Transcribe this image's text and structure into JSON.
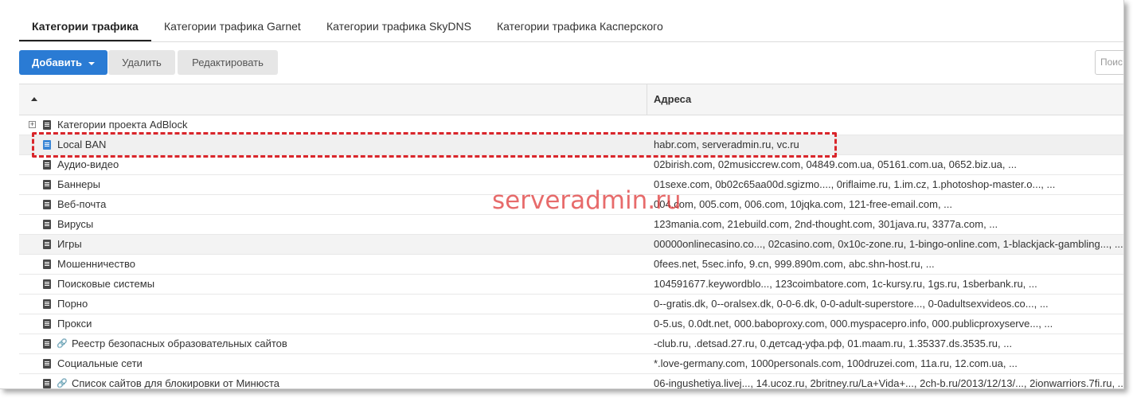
{
  "tabs": [
    {
      "label": "Категории трафика",
      "active": true
    },
    {
      "label": "Категории трафика Garnet",
      "active": false
    },
    {
      "label": "Категории трафика SkyDNS",
      "active": false
    },
    {
      "label": "Категории трафика Касперского",
      "active": false
    }
  ],
  "toolbar": {
    "add_label": "Добавить",
    "delete_label": "Удалить",
    "edit_label": "Редактировать",
    "search_placeholder": "Поис"
  },
  "table": {
    "header_addresses": "Адреса",
    "rows": [
      {
        "name": "Категории проекта AdBlock",
        "addresses": "",
        "icon": "book-icon",
        "expandable": true
      },
      {
        "name": "Local BAN",
        "addresses": "habr.com, serveradmin.ru, vc.ru",
        "icon": "book-icon",
        "selected": true
      },
      {
        "name": "Аудио-видео",
        "addresses": "02birish.com, 02musiccrew.com, 04849.com.ua, 05161.com.ua, 0652.biz.ua, ...",
        "icon": "book-icon"
      },
      {
        "name": "Баннеры",
        "addresses": "01sexe.com, 0b02c65aa00d.sgizmo...., 0riflaime.ru, 1.im.cz, 1.photoshop-master.o..., ...",
        "icon": "book-icon"
      },
      {
        "name": "Веб-почта",
        "addresses": "004.com, 005.com, 006.com, 10jqka.com, 121-free-email.com, ...",
        "icon": "book-icon"
      },
      {
        "name": "Вирусы",
        "addresses": "123mania.com, 21ebuild.com, 2nd-thought.com, 301java.ru, 3377a.com, ...",
        "icon": "book-icon"
      },
      {
        "name": "Игры",
        "addresses": "00000onlinecasino.co..., 02casino.com, 0x10c-zone.ru, 1-bingo-online.com, 1-blackjack-gambling..., ...",
        "icon": "book-icon",
        "hover": true
      },
      {
        "name": "Мошенничество",
        "addresses": "0fees.net, 5sec.info, 9.cn, 999.890m.com, abc.shn-host.ru, ...",
        "icon": "book-icon"
      },
      {
        "name": "Поисковые системы",
        "addresses": "104591677.keywordblo..., 123coimbatore.com, 1c-kursy.ru, 1gs.ru, 1sberbank.ru, ...",
        "icon": "book-icon"
      },
      {
        "name": "Порно",
        "addresses": "0--gratis.dk, 0--oralsex.dk, 0-0-6.dk, 0-0-adult-superstore..., 0-0adultsexvideos.co..., ...",
        "icon": "book-icon"
      },
      {
        "name": "Прокси",
        "addresses": "0-5.us, 0.0dt.net, 000.baboproxy.com, 000.myspacepro.info, 000.publicproxyserve..., ...",
        "icon": "book-icon"
      },
      {
        "name": "Реестр безопасных образовательных сайтов",
        "addresses": "-club.ru, .detsad.27.ru, 0.детсад-уфа.рф, 01.maam.ru, 1.35337.ds.3535.ru, ...",
        "icon": "book-icon",
        "link": true
      },
      {
        "name": "Социальные сети",
        "addresses": "*.love-germany.com, 1000personals.com, 100druzei.com, 11a.ru, 12.com.ua, ...",
        "icon": "book-icon"
      },
      {
        "name": "Список сайтов для блокировки от Минюста",
        "addresses": "06-ingushetiya.livej..., 14.ucoz.ru, 2britney.ru/La+Vida+..., 2ch-b.ru/2013/12/13/..., 2ionwarriors.7fi.ru, ...",
        "icon": "book-icon",
        "link": true
      }
    ]
  },
  "watermark": "serveradmin.ru",
  "colors": {
    "primary": "#2a7bd4",
    "highlight": "#d9262b",
    "selected_icon": "#3a86d6"
  }
}
